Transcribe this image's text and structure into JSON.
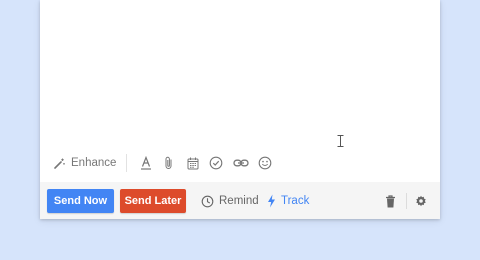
{
  "compose": {
    "toolbar": {
      "enhance_label": "Enhance",
      "icons": [
        "text-format-icon",
        "attachment-icon",
        "calendar-icon",
        "check-circle-icon",
        "link-icon",
        "emoji-icon"
      ]
    },
    "footer": {
      "send_now_label": "Send Now",
      "send_later_label": "Send Later",
      "remind_label": "Remind",
      "track_label": "Track",
      "icons": [
        "clock-icon",
        "lightning-icon",
        "trash-icon",
        "gear-icon"
      ]
    }
  },
  "colors": {
    "background": "#d6e4fb",
    "send_now": "#4285f4",
    "send_later": "#dd4b2b",
    "track": "#4285f4",
    "icon_gray": "#757575"
  }
}
